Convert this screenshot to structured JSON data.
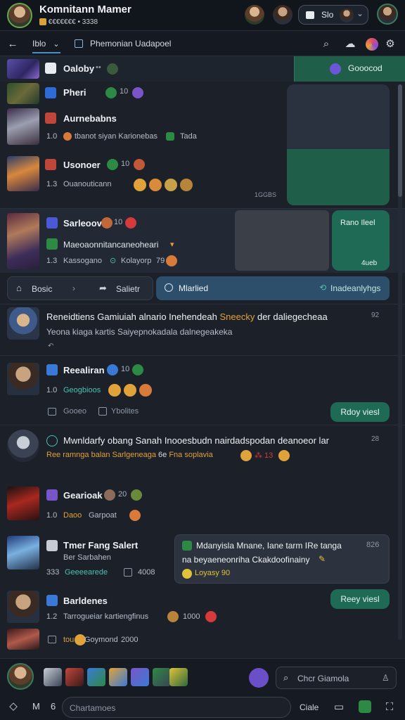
{
  "header": {
    "title": "Komnitann Mamer",
    "subtitle": "€€€€€€€ • 3338",
    "pill_label": "Slo"
  },
  "nav": {
    "back_label": "Iblo",
    "breadcrumb": "Phemonian Uadapoel"
  },
  "top_rows": [
    {
      "name": "Oaloby",
      "action": "Gooocod"
    },
    {
      "name": "Pheri"
    },
    {
      "name": "Aurnebabns",
      "meta": "1.0",
      "sub": "tbanot  siyan  Karionebas",
      "tag": "Tada"
    },
    {
      "name": "Usonoer",
      "meta": "1.3",
      "sub": "Ouanouticann",
      "counter": "1GGBS"
    },
    {
      "name": "Sarleoov",
      "num": "10",
      "sub": "Maeoaonnitancaneoheari",
      "meta": "1.3",
      "sub2": "Kassogano",
      "sub3": "Kolayorp",
      "sub3b": "79",
      "panel_label": "Rano Ileel",
      "panel_value": "4ueb"
    }
  ],
  "actions": {
    "left_label": "Bosic",
    "mid_label": "Salietr",
    "main_label": "Mlarlied",
    "right_label": "Inadeanlyhgs"
  },
  "posts": [
    {
      "title": "Reneidtiens Gamiuiah alnario Inehendeah",
      "title_hl": "Sneecky",
      "title_end": "der daliegecheaa",
      "body": "Yeona kiaga kartis Saiyepnokadala dalnegeakeka",
      "num": "92"
    },
    {
      "name": "Reealiran",
      "num": "10",
      "meta": "1.0",
      "sub": "Geogbioos",
      "act1": "Gooeo",
      "act2": "Ybolites",
      "btn": "Rdoy viesl"
    },
    {
      "title": "Mwnldarfy obang Sanah Inooesbudn nairdadspodan deanoeor lar",
      "body": "Ree ramnga balan Sarlgeneaga",
      "body2": "Fna soplavia",
      "num": "28"
    },
    {
      "name": "Gearioak",
      "num": "20",
      "meta": "1.0",
      "sub": "Daoo",
      "sub2": "Garpoat"
    },
    {
      "name": "Tmer Fang Salert",
      "sub": "Ber Sarbahen",
      "meta": "333",
      "sub2": "Geeeearede",
      "val": "4008"
    },
    {
      "msg": "Mdanyisla Mnane, Iane tarm IRe tanga",
      "msg_num": "826",
      "msg2": "na beyaeneonriha Ckakdoofinainy",
      "msg3": "Loyasy 90"
    },
    {
      "name": "Barldenes",
      "meta": "1.2",
      "sub": "Tarrogueiar kartiengfinus",
      "val": "1000",
      "btn": "Reey viesl"
    },
    {
      "sub": "Goymond",
      "val": "2000",
      "prefix": "tou"
    }
  ],
  "footer": {
    "search_placeholder": "Chcr Giamola",
    "input_placeholder": "Chartamoes",
    "nav_label": "Ciale",
    "n_label": "M"
  },
  "colors": {
    "accent_green": "#1f6a55",
    "accent_blue": "#2d4f6b",
    "bg": "#1b2029"
  }
}
